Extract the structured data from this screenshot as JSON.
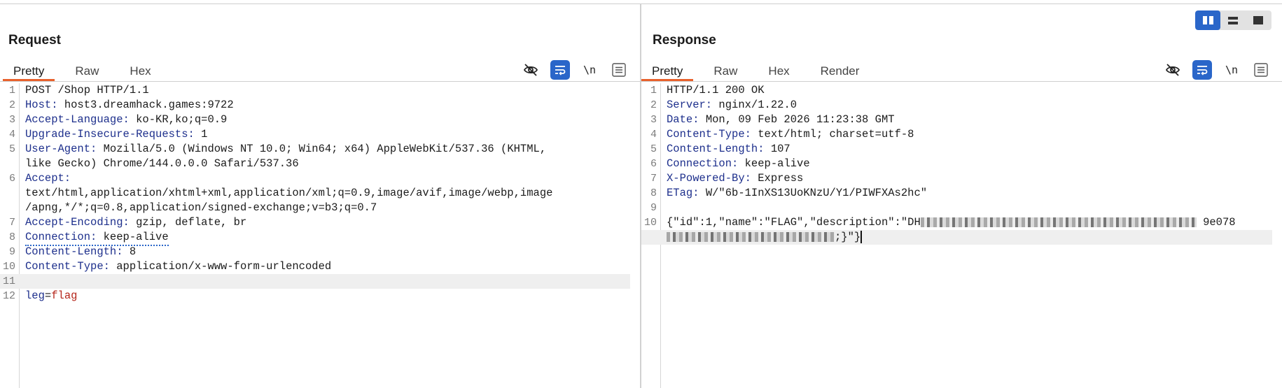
{
  "request": {
    "title": "Request",
    "tabs": [
      "Pretty",
      "Raw",
      "Hex"
    ],
    "active_tab": "Pretty",
    "newline_label": "\\n",
    "lines": [
      {
        "n": "1",
        "method": "POST /Shop HTTP/1.1"
      },
      {
        "n": "2",
        "key": "Host:",
        "value": " host3.dreamhack.games:9722"
      },
      {
        "n": "3",
        "key": "Accept-Language:",
        "value": " ko-KR,ko;q=0.9"
      },
      {
        "n": "4",
        "key": "Upgrade-Insecure-Requests:",
        "value": " 1"
      },
      {
        "n": "5",
        "key": "User-Agent:",
        "value": " Mozilla/5.0 (Windows NT 10.0; Win64; x64) AppleWebKit/537.36 (KHTML,",
        "cont": "like Gecko) Chrome/144.0.0.0 Safari/537.36"
      },
      {
        "n": "6",
        "key": "Accept:",
        "cont": "text/html,application/xhtml+xml,application/xml;q=0.9,image/avif,image/webp,image",
        "cont2": "/apng,*/*;q=0.8,application/signed-exchange;v=b3;q=0.7"
      },
      {
        "n": "7",
        "key": "Accept-Encoding:",
        "value": " gzip, deflate, br"
      },
      {
        "n": "8",
        "key": "Connection:",
        "value": " keep-alive"
      },
      {
        "n": "9",
        "key": "Content-Length:",
        "value": " 8"
      },
      {
        "n": "10",
        "key": "Content-Type:",
        "value": " application/x-www-form-urlencoded"
      },
      {
        "n": "11"
      },
      {
        "n": "12",
        "param_key": "leg",
        "param_eq": "=",
        "param_value": "flag"
      }
    ]
  },
  "response": {
    "title": "Response",
    "tabs": [
      "Pretty",
      "Raw",
      "Hex",
      "Render"
    ],
    "active_tab": "Pretty",
    "newline_label": "\\n",
    "lines": [
      {
        "n": "1",
        "status": "HTTP/1.1 200 OK"
      },
      {
        "n": "2",
        "key": "Server:",
        "value": " nginx/1.22.0"
      },
      {
        "n": "3",
        "key": "Date:",
        "value": " Mon, 09 Feb 2026 11:23:38 GMT"
      },
      {
        "n": "4",
        "key": "Content-Type:",
        "value": " text/html; charset=utf-8"
      },
      {
        "n": "5",
        "key": "Content-Length:",
        "value": " 107"
      },
      {
        "n": "6",
        "key": "Connection:",
        "value": " keep-alive"
      },
      {
        "n": "7",
        "key": "X-Powered-By:",
        "value": " Express"
      },
      {
        "n": "8",
        "key": "ETag:",
        "value": " W/\"6b-1InXS13UoKNzU/Y1/PIWFXAs2hc\""
      },
      {
        "n": "9"
      },
      {
        "n": "10",
        "body_start": "{\"id\":1,\"name\":\"FLAG\",\"description\":\"DH",
        "body_mid": "9e078",
        "body_end": ";}\"}"
      }
    ]
  },
  "layout_toggle": [
    "split-vertical",
    "split-horizontal",
    "single-pane"
  ]
}
